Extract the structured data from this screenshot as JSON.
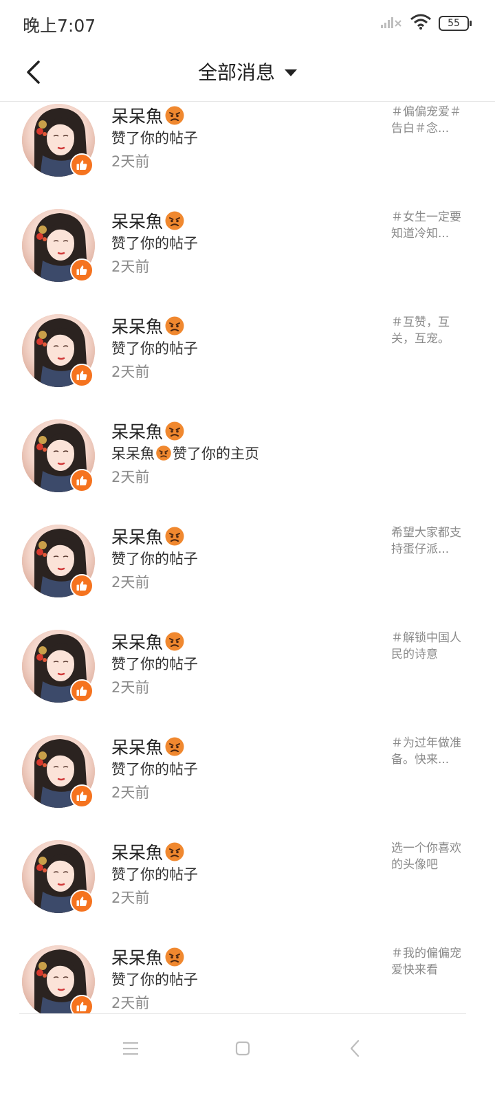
{
  "status_bar": {
    "time": "晚上7:07",
    "battery": "55",
    "icons": [
      "signal-icon",
      "wifi-icon",
      "battery-icon"
    ]
  },
  "header": {
    "back_icon": "back-arrow-icon",
    "title": "全部消息",
    "dropdown_icon": "caret-down-icon"
  },
  "notifications": [
    {
      "name": "呆呆魚",
      "action": "赞了你的帖子",
      "time": "2天前",
      "preview": "＃偏偏宠爱＃告白＃念..."
    },
    {
      "name": "呆呆魚",
      "action": "赞了你的帖子",
      "time": "2天前",
      "preview": "＃女生一定要知道冷知..."
    },
    {
      "name": "呆呆魚",
      "action": "赞了你的帖子",
      "time": "2天前",
      "preview": "＃互赞，互关，互宠。"
    },
    {
      "name": "呆呆魚",
      "action_prefix": "呆呆魚",
      "action_suffix": "赞了你的主页",
      "time": "2天前",
      "preview": ""
    },
    {
      "name": "呆呆魚",
      "action": "赞了你的帖子",
      "time": "2天前",
      "preview": "希望大家都支持蛋仔派..."
    },
    {
      "name": "呆呆魚",
      "action": "赞了你的帖子",
      "time": "2天前",
      "preview": "＃解锁中国人民的诗意"
    },
    {
      "name": "呆呆魚",
      "action": "赞了你的帖子",
      "time": "2天前",
      "preview": "＃为过年做准备。快来..."
    },
    {
      "name": "呆呆魚",
      "action": "赞了你的帖子",
      "time": "2天前",
      "preview": "选一个你喜欢的头像吧"
    },
    {
      "name": "呆呆魚",
      "action": "赞了你的帖子",
      "time": "2天前",
      "preview": "＃我的偏偏宠爱快来看"
    }
  ],
  "nav": {
    "menu_icon": "menu-icon",
    "home_icon": "home-square-icon",
    "back_icon": "nav-back-icon"
  },
  "colors": {
    "accent": "#f5731f",
    "muted_text": "#8a8a8a",
    "emoji_face": "#f0882f"
  }
}
